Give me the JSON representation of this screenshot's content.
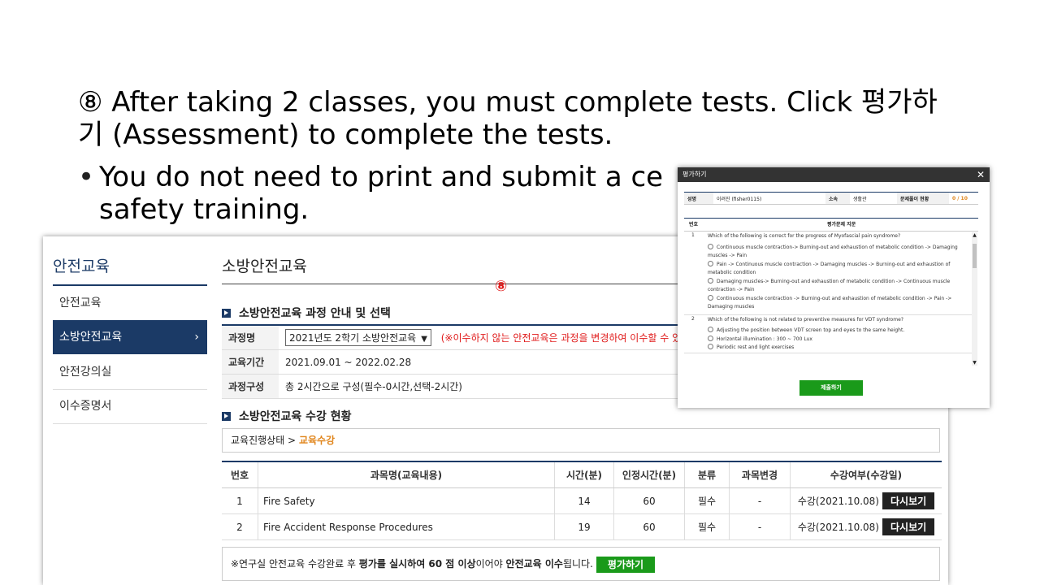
{
  "slide": {
    "step_line1": "⑧ After taking 2 classes, you must complete tests. Click 평가하",
    "step_line2": "기 (Assessment) to complete the tests.",
    "bullet_symbol": "•",
    "bullet_line1": "You do not need to print and submit a ce",
    "bullet_line2": "safety training."
  },
  "sidebar": {
    "title": "안전교육",
    "items": [
      {
        "label": "안전교육"
      },
      {
        "label": "소방안전교육",
        "chevron": "›"
      },
      {
        "label": "안전강의실"
      },
      {
        "label": "이수증명서"
      }
    ]
  },
  "main": {
    "page_title": "소방안전교육",
    "step_marker": "⑧",
    "section1_title": "소방안전교육 과정 안내 및 선택",
    "info": {
      "course_label": "과정명",
      "course_value": "2021년도 2학기 소방안전교육",
      "course_note": "(※이수하지 않는 안전교육은 과정을 변경하여 이수할 수 있",
      "period_label": "교육기간",
      "period_value": "2021.09.01 ~ 2022.02.28",
      "composition_label": "과정구성",
      "composition_value": "총 2시간으로 구성(필수-0시간,선택-2시간)"
    },
    "section2_title": "소방안전교육 수강 현황",
    "status": {
      "prefix": "교육진행상태 > ",
      "current": "교육수강"
    },
    "table": {
      "headers": [
        "번호",
        "과목명(교육내용)",
        "시간(분)",
        "인정시간(분)",
        "분류",
        "과목변경",
        "수강여부(수강일)"
      ],
      "rows": [
        {
          "no": "1",
          "name": "Fire Safety",
          "time": "14",
          "credit": "60",
          "type": "필수",
          "change": "-",
          "status": "수강(2021.10.08)",
          "button": "다시보기"
        },
        {
          "no": "2",
          "name": "Fire Accident Response Procedures",
          "time": "19",
          "credit": "60",
          "type": "필수",
          "change": "-",
          "status": "수강(2021.10.08)",
          "button": "다시보기"
        }
      ]
    },
    "bottom_note": {
      "part1": "※연구실 안전교육 수강완료 후 ",
      "part2": "평가를 실시하여 60 점 이상",
      "part3": "이어야 ",
      "part4": "안전교육 이수",
      "part5": "됩니다.",
      "button": "평가하기"
    }
  },
  "popup": {
    "title": "평가하기",
    "close": "✕",
    "info": {
      "name_label": "성명",
      "name_value": "이려진 (fisher0115)",
      "dept_label": "소속",
      "dept_value": "생활관",
      "progress_label": "문제풀이 현황",
      "progress_value": "0 / 10"
    },
    "q_header_num": "번호",
    "q_header_title": "평가문제 지문",
    "questions": [
      {
        "no": "1",
        "text": "Which of the following is correct for the progress of Myofascial pain syndrome?",
        "options": [
          "Continuous muscle contraction-> Burning-out and exhaustion of metabolic condition -> Damaging muscles -> Pain",
          "Pain -> Continuous muscle contraction -> Damaging muscles -> Burning-out and exhaustion of metabolic condition",
          "Damaging muscles-> Burning-out and exhaustion of metabolic condition -> Continuous muscle contraction -> Pain",
          "Continuous muscle contraction -> Burning-out and exhaustion of metabolic condition -> Pain -> Damaging muscles"
        ]
      },
      {
        "no": "2",
        "text": "Which of the following is not related to preventive measures for VDT syndrome?",
        "options": [
          "Adjusting the position between VDT screen top and eyes to the same height.",
          "Horizontal illumination : 300 ~ 700 Lux",
          "Periodic rest and light exercises"
        ]
      }
    ],
    "submit": "제출하기"
  }
}
